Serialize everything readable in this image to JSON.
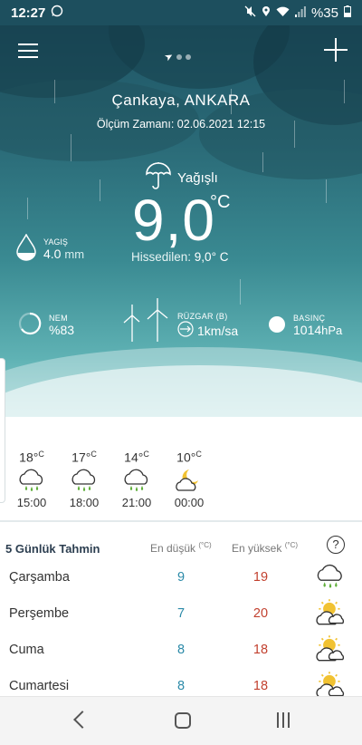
{
  "status": {
    "time": "12:27",
    "battery": "%35"
  },
  "location": {
    "city": "Çankaya,  ANKARA",
    "measured": "Ölçüm Zamanı: 02.06.2021 12:15"
  },
  "current": {
    "condition": "Yağışlı",
    "temp": "9,0",
    "temp_unit": "°C",
    "feels_label": "Hissedilen:",
    "feels_value": "9,0° C"
  },
  "rain": {
    "label": "YAGIŞ",
    "value": "4.0",
    "unit": "mm"
  },
  "humidity": {
    "label": "NEM",
    "value": "%83"
  },
  "wind": {
    "label": "RÜZGAR (B)",
    "value": "1km/sa"
  },
  "pressure": {
    "label": "BASINÇ",
    "value": "1014",
    "unit": "hPa"
  },
  "hourly": [
    {
      "temp": "18°",
      "unit": "C",
      "hour": "15:00",
      "icon": "rain-cloud-icon"
    },
    {
      "temp": "17°",
      "unit": "C",
      "hour": "18:00",
      "icon": "rain-cloud-icon"
    },
    {
      "temp": "14°",
      "unit": "C",
      "hour": "21:00",
      "icon": "rain-cloud-icon"
    },
    {
      "temp": "10°",
      "unit": "C",
      "hour": "00:00",
      "icon": "moon-cloud-icon"
    }
  ],
  "forecast": {
    "title": "5 Günlük Tahmin",
    "low_label": "En düşük",
    "high_label": "En yüksek",
    "unit": "(°C)",
    "days": [
      {
        "day": "Çarşamba",
        "low": "9",
        "high": "19",
        "icon": "rain-cloud-icon"
      },
      {
        "day": "Perşembe",
        "low": "7",
        "high": "20",
        "icon": "sun-cloud-icon"
      },
      {
        "day": "Cuma",
        "low": "8",
        "high": "18",
        "icon": "sun-cloud-icon"
      },
      {
        "day": "Cumartesi",
        "low": "8",
        "high": "18",
        "icon": "sun-cloud-icon"
      }
    ]
  },
  "colors": {
    "low": "#2b8aa8",
    "high": "#c2412f",
    "rain_drop": "#5fae3a"
  }
}
